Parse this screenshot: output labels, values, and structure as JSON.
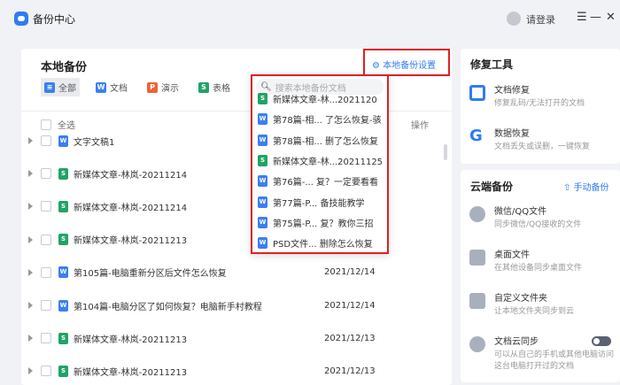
{
  "app": {
    "title": "备份中心",
    "login": "请登录",
    "menu_icon": "☰",
    "minimize_icon": "—",
    "close_icon": "✕"
  },
  "main": {
    "title": "本地备份",
    "settings_label": "本地备份设置",
    "filters": [
      {
        "label": "全部",
        "icon": "≡",
        "color": "#3b7ff0"
      },
      {
        "label": "文档",
        "icon": "W",
        "color": "#3b7ff0"
      },
      {
        "label": "演示",
        "icon": "P",
        "color": "#f06234"
      },
      {
        "label": "表格",
        "icon": "S",
        "color": "#21a366"
      }
    ],
    "select_all": "全选",
    "op_header": "操作",
    "rows": [
      {
        "name": "文字文稿1",
        "type": "w",
        "date": ""
      },
      {
        "name": "新媒体文章-林岚-20211214",
        "type": "s",
        "date": ""
      },
      {
        "name": "新媒体文章-林岚-20211214",
        "type": "s",
        "date": ""
      },
      {
        "name": "新媒体文章-林岚-20211213",
        "type": "s",
        "date": ""
      },
      {
        "name": "第105篇-电脑重新分区后文件怎么恢复",
        "type": "w",
        "date": "2021/12/14"
      },
      {
        "name": "第104篇-电脑分区了如何恢复？电脑新手村教程",
        "type": "w",
        "date": "2021/12/14"
      },
      {
        "name": "新媒体文章-林岚-20211213",
        "type": "s",
        "date": "2021/12/13"
      },
      {
        "name": "新媒体文章-林岚-20211213",
        "type": "s",
        "date": "2021/12/13"
      }
    ]
  },
  "dropdown": {
    "placeholder": "搜索本地备份文档",
    "items": [
      {
        "name": "新媒体文章-林...2021120",
        "type": "s"
      },
      {
        "name": "第78篇-相... 了怎么恢复-骇",
        "type": "w"
      },
      {
        "name": "第78篇-相... 删了怎么恢复",
        "type": "w"
      },
      {
        "name": "新媒体文章-林...20211125",
        "type": "s"
      },
      {
        "name": "第76篇-...  复？一定要看看",
        "type": "w"
      },
      {
        "name": "第77篇-P...  备技能教学",
        "type": "w"
      },
      {
        "name": "第75篇-P... 复？教你三招",
        "type": "w"
      },
      {
        "name": "PSD文件...  删除怎么恢复",
        "type": "w"
      }
    ]
  },
  "repair": {
    "title": "修复工具",
    "items": [
      {
        "title": "文档修复",
        "desc": "修复乱码/无法打开的文档"
      },
      {
        "title": "数据恢复",
        "desc": "文档丢失或误删，一键恢复"
      }
    ]
  },
  "cloud": {
    "title": "云端备份",
    "manual": "手动备份",
    "items": [
      {
        "title": "微信/QQ文件",
        "desc": "同步微信/QQ接收的文件"
      },
      {
        "title": "桌面文件",
        "desc": "在其他设备同步桌面文件"
      },
      {
        "title": "自定义文件夹",
        "desc": "让本地文件夹同步到云"
      },
      {
        "title": "文档云同步",
        "desc": "可以从自己的手机或其他电脑访问这台电脑打开过的文档",
        "toggle": false
      }
    ]
  }
}
